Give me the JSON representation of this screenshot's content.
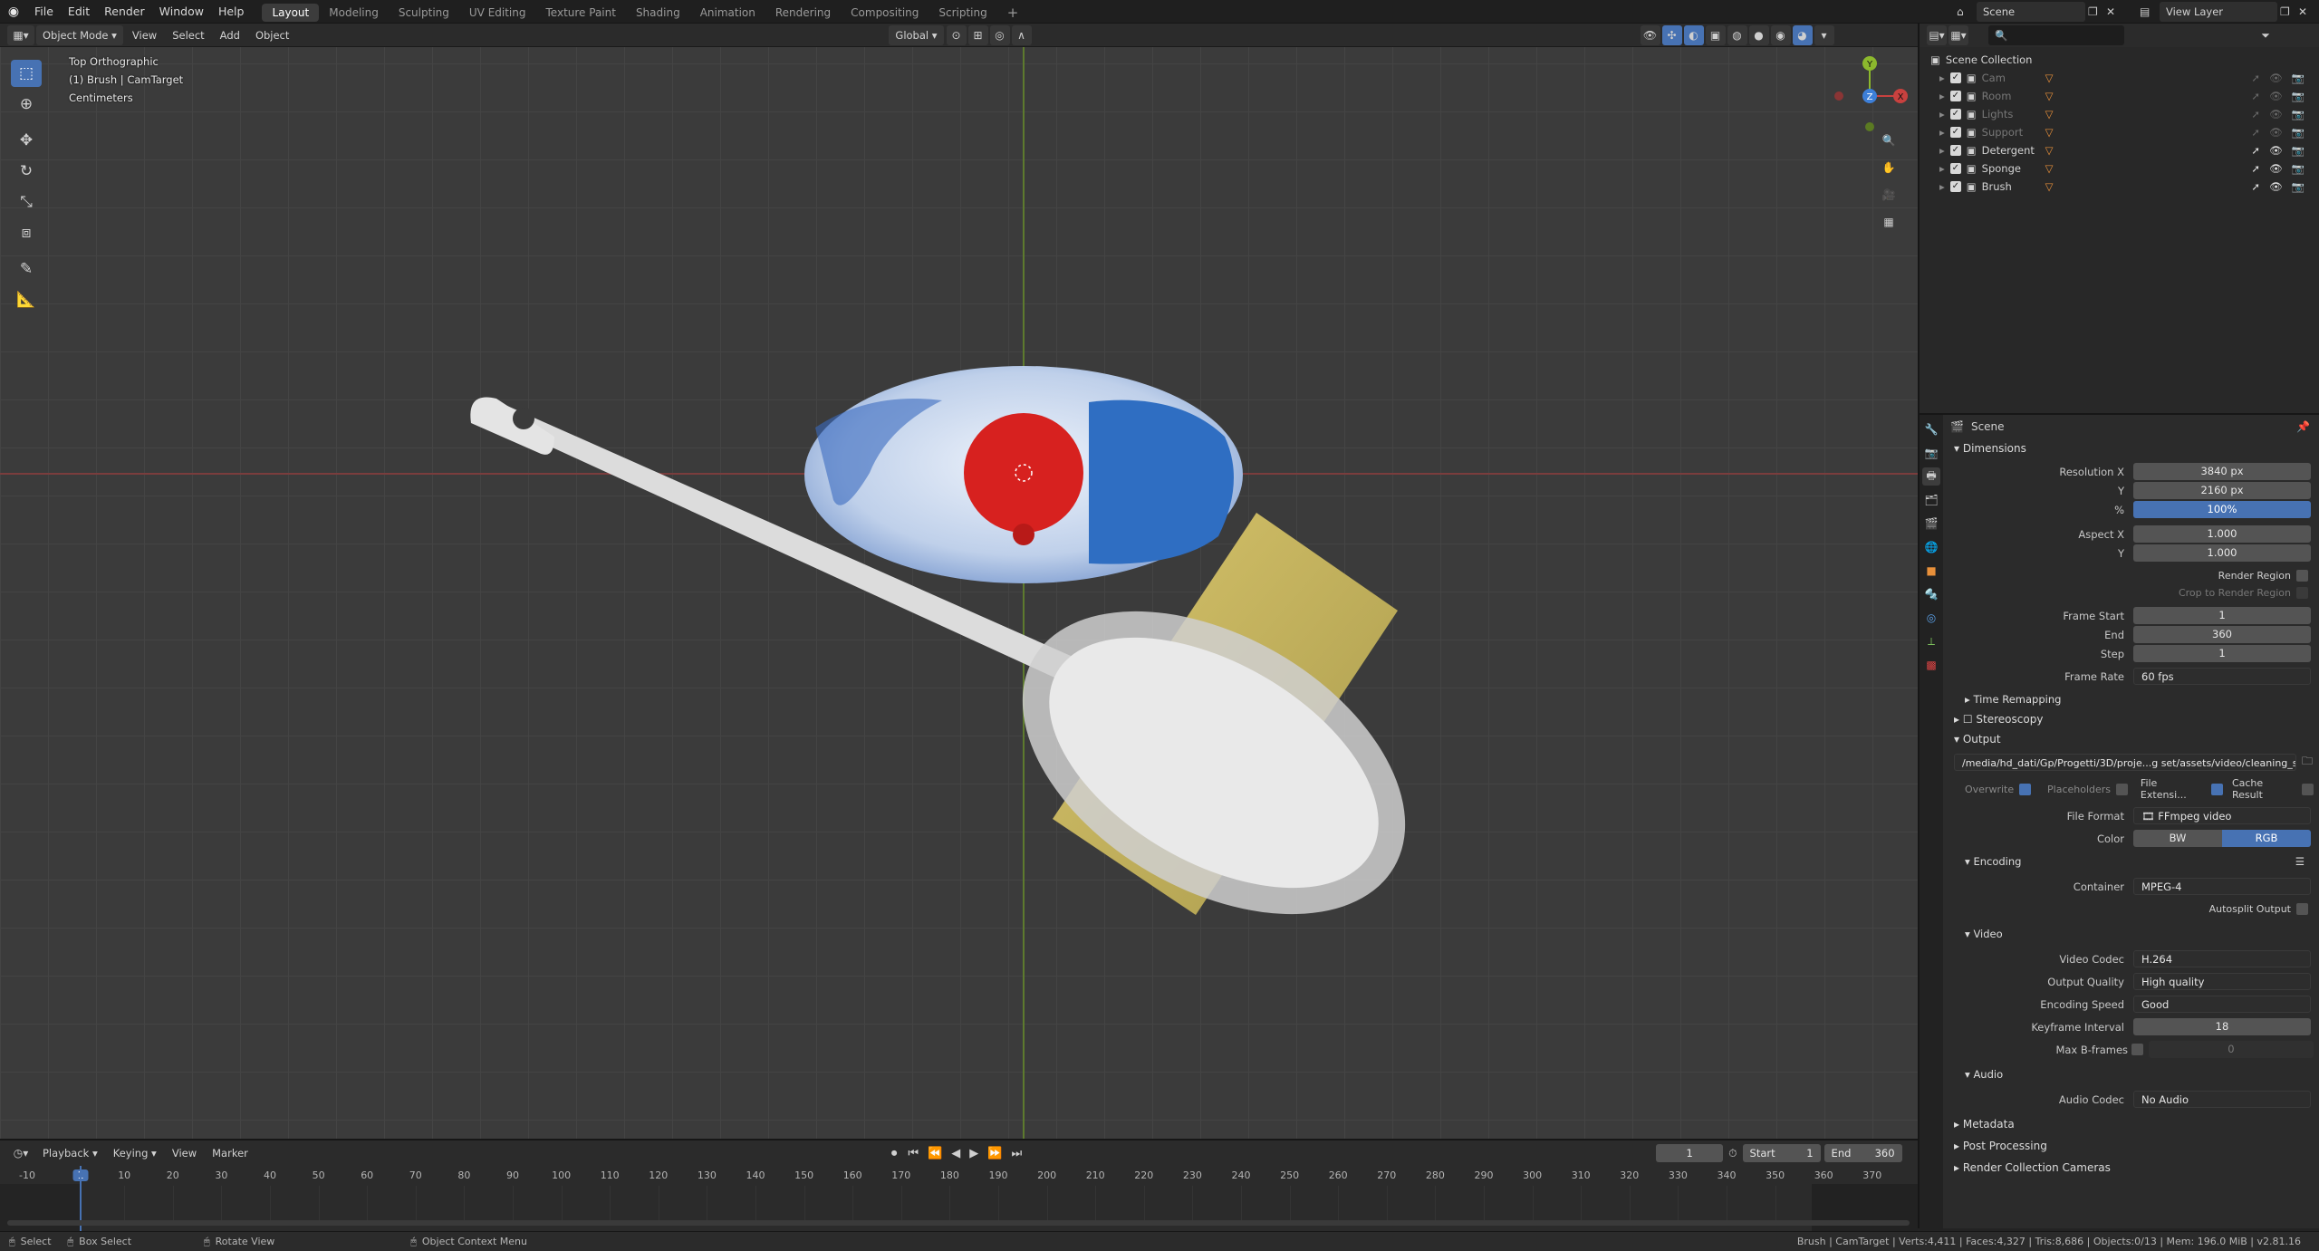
{
  "topbar": {
    "menus": [
      "File",
      "Edit",
      "Render",
      "Window",
      "Help"
    ],
    "workspaces": [
      "Layout",
      "Modeling",
      "Sculpting",
      "UV Editing",
      "Texture Paint",
      "Shading",
      "Animation",
      "Rendering",
      "Compositing",
      "Scripting"
    ],
    "active_workspace": "Layout",
    "scene_name": "Scene",
    "view_layer": "View Layer"
  },
  "viewport_header": {
    "mode": "Object Mode",
    "menus": [
      "View",
      "Select",
      "Add",
      "Object"
    ],
    "orientation": "Global"
  },
  "viewport": {
    "view_name": "Top Orthographic",
    "active_object": "(1) Brush | CamTarget",
    "units": "Centimeters"
  },
  "gizmo": {
    "x": "X",
    "y": "Y",
    "z": "Z"
  },
  "outliner": {
    "root": "Scene Collection",
    "items": [
      {
        "label": "Cam",
        "enabled": false
      },
      {
        "label": "Room",
        "enabled": false
      },
      {
        "label": "Lights",
        "enabled": false
      },
      {
        "label": "Support",
        "enabled": false
      },
      {
        "label": "Detergent",
        "enabled": true
      },
      {
        "label": "Sponge",
        "enabled": true
      },
      {
        "label": "Brush",
        "enabled": true
      }
    ]
  },
  "properties": {
    "context": "Scene",
    "dimensions": {
      "title": "Dimensions",
      "res_x_label": "Resolution X",
      "res_x": "3840 px",
      "res_y_label": "Y",
      "res_y": "2160 px",
      "pct_label": "%",
      "pct": "100%",
      "aspect_x_label": "Aspect X",
      "aspect_x": "1.000",
      "aspect_y_label": "Y",
      "aspect_y": "1.000",
      "render_region": "Render Region",
      "crop": "Crop to Render Region",
      "frame_start_label": "Frame Start",
      "frame_start": "1",
      "end_label": "End",
      "end": "360",
      "step_label": "Step",
      "step": "1",
      "frame_rate_label": "Frame Rate",
      "frame_rate": "60 fps"
    },
    "time_remapping": "Time Remapping",
    "stereoscopy": "Stereoscopy",
    "output": {
      "title": "Output",
      "path": "/media/hd_dati/Gp/Progetti/3D/proje...g set/assets/video/cleaning_set.mp4",
      "overwrite": "Overwrite",
      "placeholders": "Placeholders",
      "file_ext": "File Extensi...",
      "cache_result": "Cache Result",
      "file_format_label": "File Format",
      "file_format": "FFmpeg video",
      "color_label": "Color",
      "color_bw": "BW",
      "color_rgb": "RGB"
    },
    "encoding": {
      "title": "Encoding",
      "container_label": "Container",
      "container": "MPEG-4",
      "autosplit": "Autosplit Output"
    },
    "video": {
      "title": "Video",
      "codec_label": "Video Codec",
      "codec": "H.264",
      "quality_label": "Output Quality",
      "quality": "High quality",
      "speed_label": "Encoding Speed",
      "speed": "Good",
      "keyframe_label": "Keyframe Interval",
      "keyframe": "18",
      "bframes_label": "Max B-frames",
      "bframes": "0"
    },
    "audio": {
      "title": "Audio",
      "codec_label": "Audio Codec",
      "codec": "No Audio"
    },
    "metadata": "Metadata",
    "post_processing": "Post Processing",
    "render_collection_cameras": "Render Collection Cameras"
  },
  "timeline": {
    "menus": [
      "Playback",
      "Keying",
      "View",
      "Marker"
    ],
    "current_frame": "1",
    "start_label": "Start",
    "start": "1",
    "end_label": "End",
    "end": "360",
    "ruler_ticks": [
      "-10",
      "1",
      "10",
      "20",
      "30",
      "40",
      "50",
      "60",
      "70",
      "80",
      "90",
      "100",
      "110",
      "120",
      "130",
      "140",
      "150",
      "160",
      "170",
      "180",
      "190",
      "200",
      "210",
      "220",
      "230",
      "240",
      "250",
      "260",
      "270",
      "280",
      "290",
      "300",
      "310",
      "320",
      "330",
      "340",
      "350",
      "360",
      "370"
    ]
  },
  "statusbar": {
    "select": "Select",
    "box_select": "Box Select",
    "rotate_view": "Rotate View",
    "context_menu": "Object Context Menu",
    "stats": "Brush | CamTarget | Verts:4,411 | Faces:4,327 | Tris:8,686 | Objects:0/13 | Mem: 196.0 MiB | v2.81.16"
  },
  "colors": {
    "accent": "#4772b3",
    "x_axis": "#c8413f",
    "y_axis": "#8cb82d",
    "z_axis": "#3d7fd8"
  }
}
